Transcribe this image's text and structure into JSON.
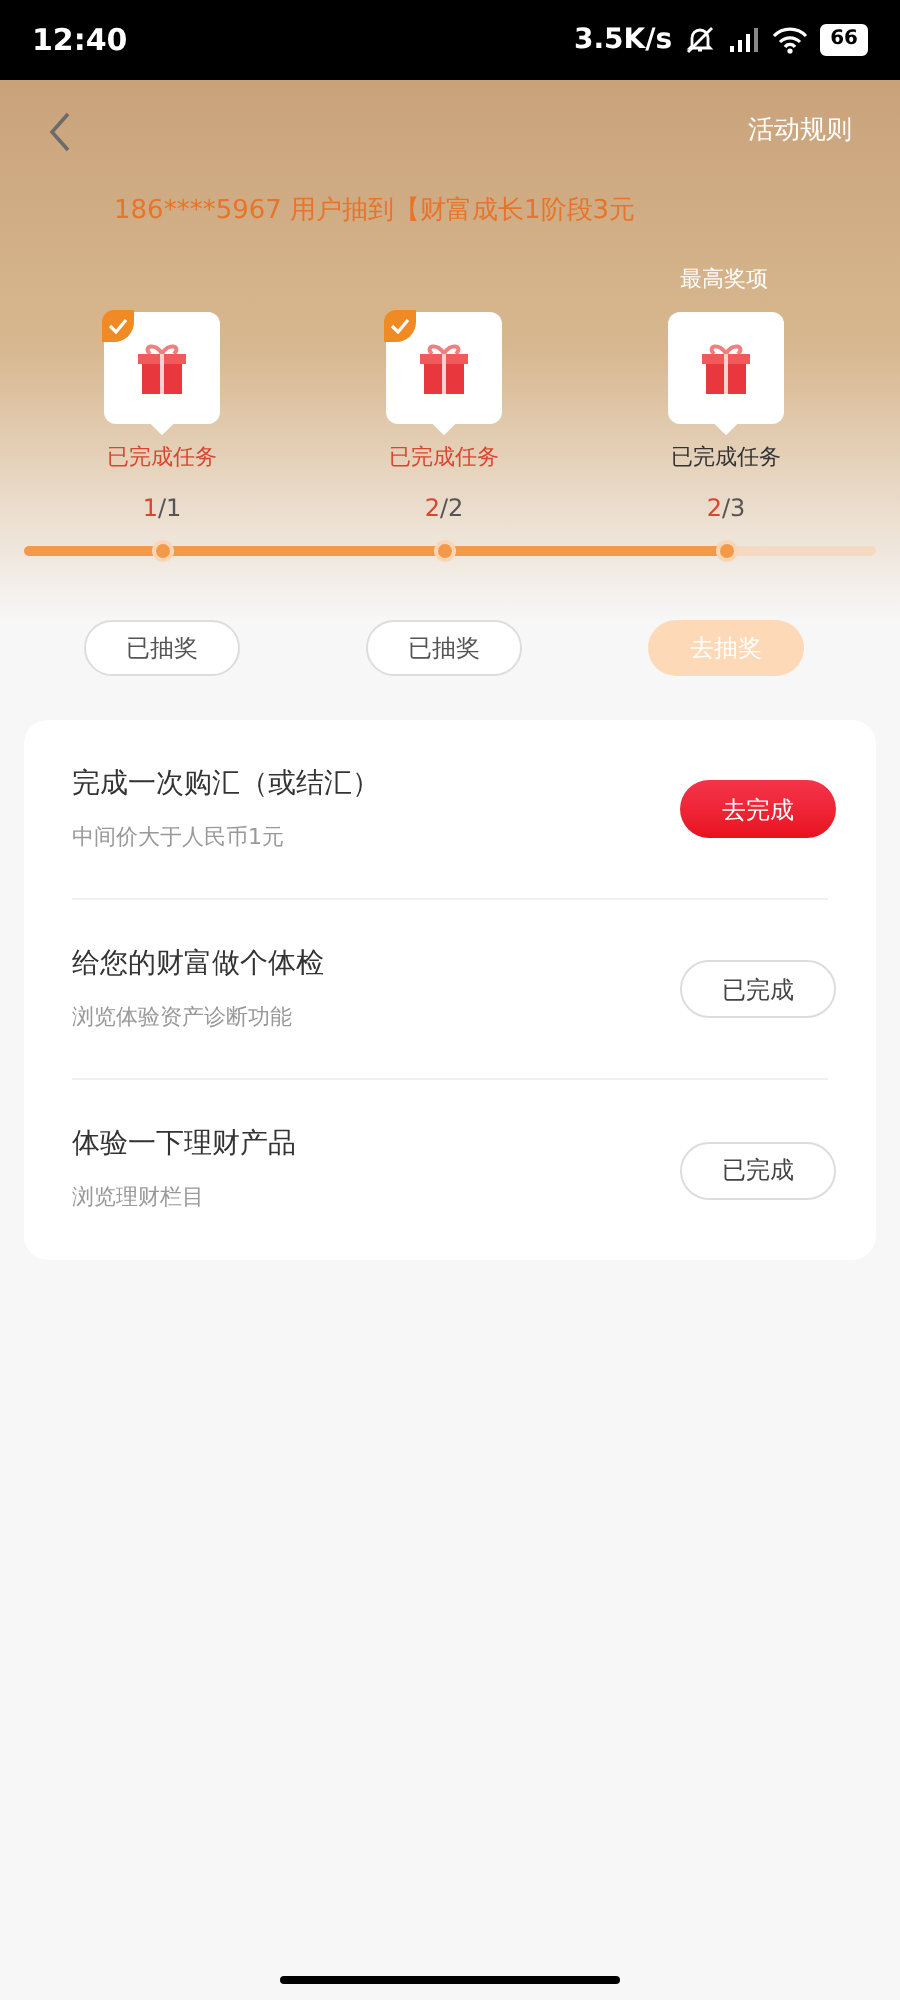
{
  "status_bar": {
    "time": "12:40",
    "speed": "3.5K/s",
    "battery": "66"
  },
  "header": {
    "rules_link": "活动规则",
    "ticker": "186****5967 用户抽到【财富成长1阶段3元"
  },
  "top_prize_label": "最高奖项",
  "progress": {
    "level": 0.82
  },
  "milestones": [
    {
      "checked": true,
      "label": "已完成任务",
      "done": "1",
      "rest": "/1",
      "button": "已抽奖",
      "kind": "drawn"
    },
    {
      "checked": true,
      "label": "已完成任务",
      "done": "2",
      "rest": "/2",
      "button": "已抽奖",
      "kind": "drawn"
    },
    {
      "checked": false,
      "label": "已完成任务",
      "done": "2",
      "rest": "/3",
      "button": "去抽奖",
      "kind": "available"
    }
  ],
  "tasks": [
    {
      "title": "完成一次购汇（或结汇）",
      "subtitle": "中间价大于人民币1元",
      "button": "去完成",
      "kind": "todo"
    },
    {
      "title": "给您的财富做个体检",
      "subtitle": "浏览体验资产诊断功能",
      "button": "已完成",
      "kind": "done"
    },
    {
      "title": "体验一下理财产品",
      "subtitle": "浏览理财栏目",
      "button": "已完成",
      "kind": "done"
    }
  ]
}
